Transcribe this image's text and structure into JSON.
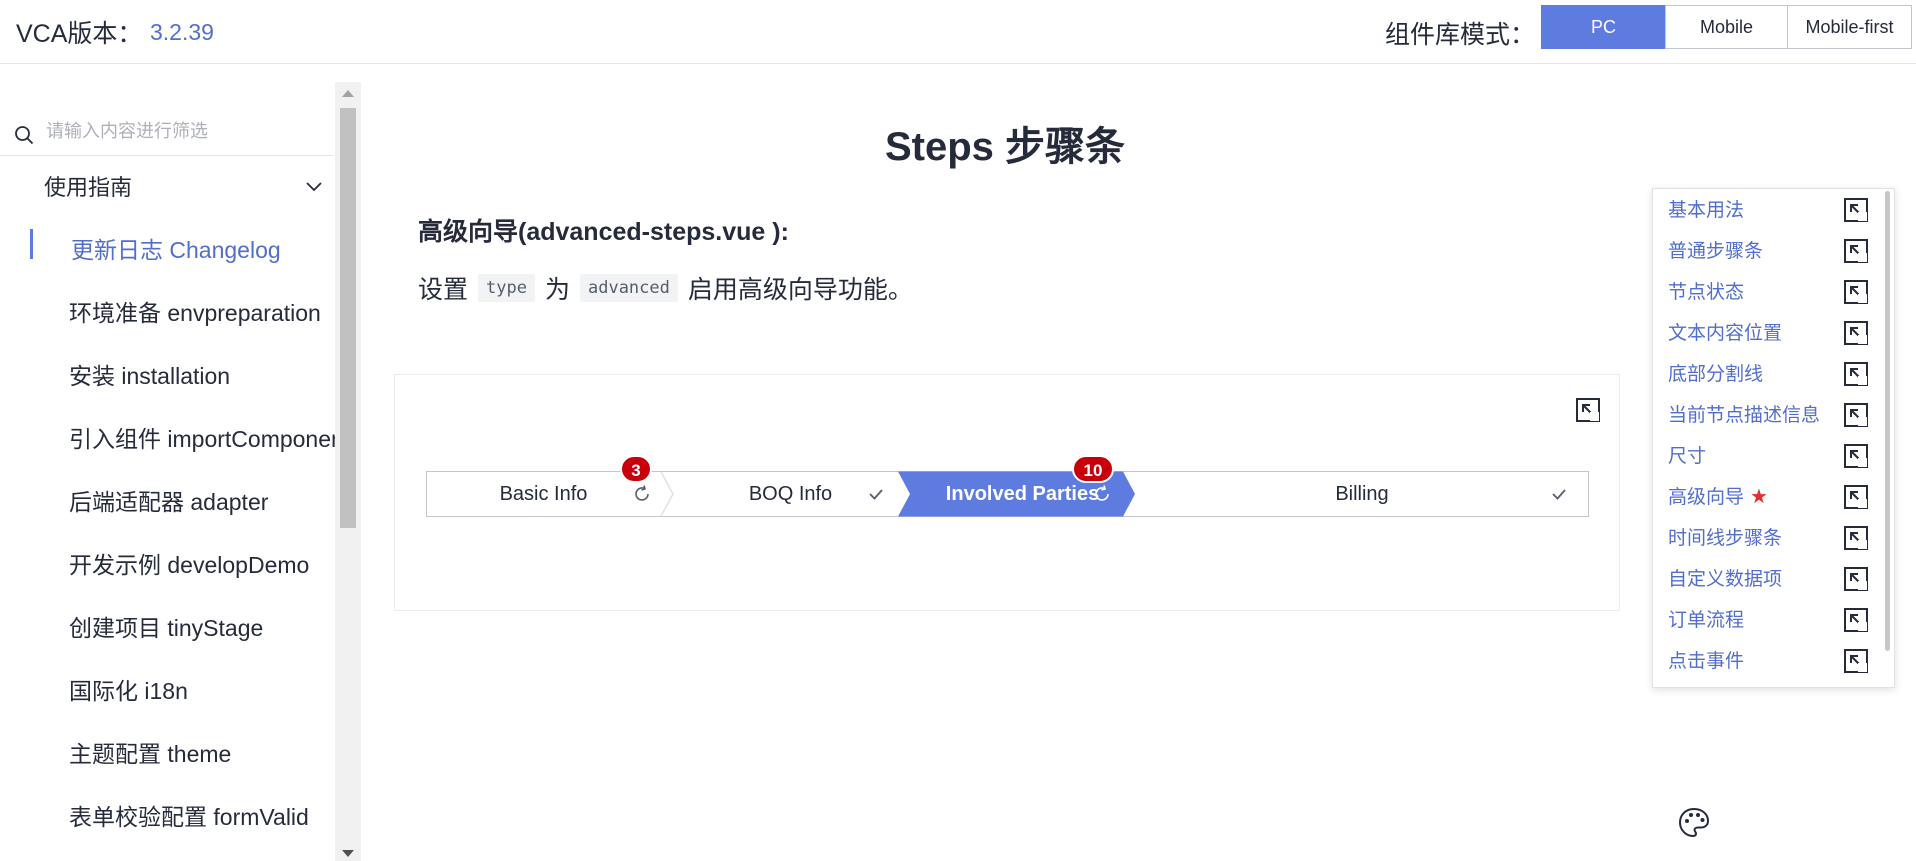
{
  "header": {
    "version_label": "VCA版本：",
    "version_value": "3.2.39",
    "mode_label": "组件库模式：",
    "modes": [
      "PC",
      "Mobile",
      "Mobile-first"
    ],
    "active_mode": "PC"
  },
  "sidebar": {
    "search_placeholder": "请输入内容进行筛选",
    "group_title": "使用指南",
    "items": [
      "更新日志 Changelog",
      "环境准备 envpreparation",
      "安装 installation",
      "引入组件 importComponents",
      "后端适配器 adapter",
      "开发示例 developDemo",
      "创建项目 tinyStage",
      "国际化 i18n",
      "主题配置 theme",
      "表单校验配置 formValid"
    ],
    "active_index": 0
  },
  "main": {
    "page_title": "Steps 步骤条",
    "demo_title": "高级向导(advanced-steps.vue ):",
    "desc_prefix": "设置",
    "desc_code1": "type",
    "desc_middle": "为",
    "desc_code2": "advanced",
    "desc_suffix": "启用高级向导功能。"
  },
  "steps": [
    {
      "label": "Basic Info",
      "status": "doing",
      "badge": "3"
    },
    {
      "label": "BOQ Info",
      "status": "done",
      "badge": ""
    },
    {
      "label": "Involved Parties",
      "status": "current",
      "badge": "10"
    },
    {
      "label": "Billing",
      "status": "done",
      "badge": ""
    }
  ],
  "anchor": {
    "items": [
      "基本用法",
      "普通步骤条",
      "节点状态",
      "文本内容位置",
      "底部分割线",
      "当前节点描述信息",
      "尺寸",
      "高级向导",
      "时间线步骤条",
      "自定义数据项",
      "订单流程",
      "点击事件"
    ],
    "starred_index": 7,
    "star_icon": "star-icon"
  },
  "colors": {
    "brand": "#5e7ce0",
    "link": "#526ecc",
    "badge": "#c7000b",
    "star": "#e52e2e"
  }
}
